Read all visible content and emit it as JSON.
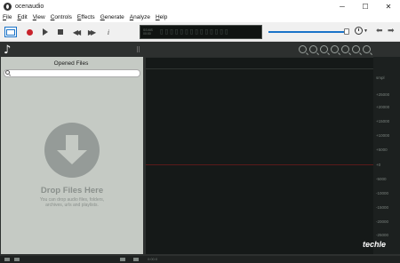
{
  "window": {
    "title": "ocenaudio"
  },
  "menu": {
    "items": [
      "File",
      "Edit",
      "View",
      "Controls",
      "Effects",
      "Generate",
      "Analyze",
      "Help"
    ]
  },
  "display": {
    "small": "SS:MS\n00:00",
    "digits": "▯▯▯▯▯▯▯▯▯▯▯▯▯▯"
  },
  "volume": {
    "level": 1.0
  },
  "files_panel": {
    "title": "Opened Files",
    "search_placeholder": "",
    "drop_title": "Drop Files Here",
    "drop_subtitle": "You can drop audio files, folders, archives, urls and playlists."
  },
  "scale": {
    "labels": [
      "smpl",
      "+25000",
      "+20000",
      "+15000",
      "+10000",
      "+5000",
      "+0",
      "-5000",
      "-10000",
      "-15000",
      "-20000",
      "-25000"
    ]
  },
  "brand": {
    "text": "techle"
  },
  "timeline": {
    "label": "0:00:0"
  },
  "colors": {
    "accent": "#1a73c8",
    "record": "#c8232c",
    "panel": "#c5cac4",
    "wave_bg": "#151918"
  }
}
